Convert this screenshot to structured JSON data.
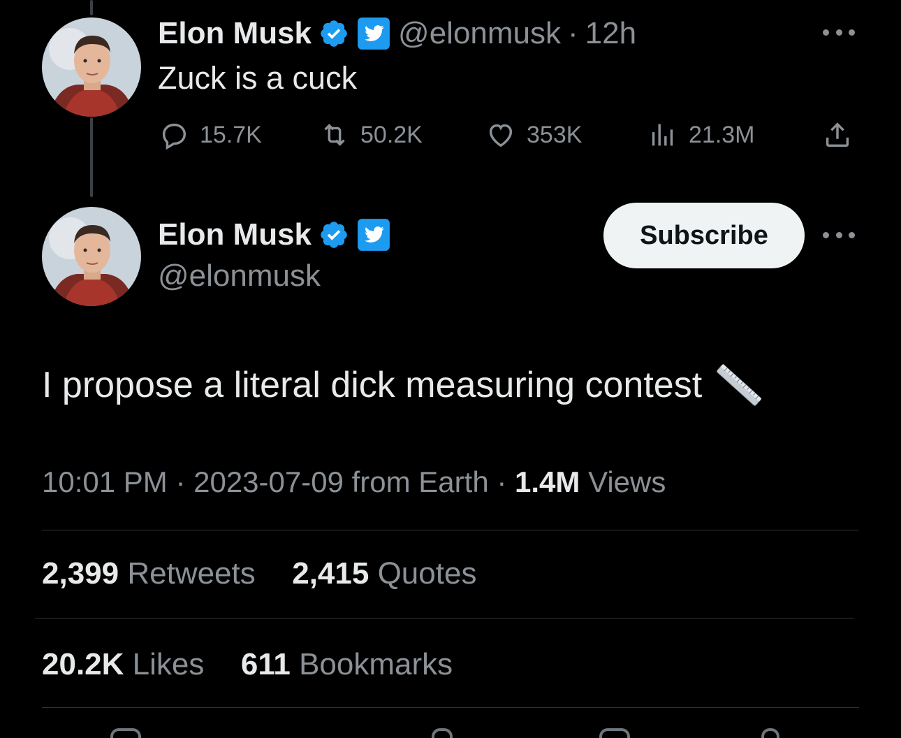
{
  "reply_tweet": {
    "author_name": "Elon Musk",
    "handle": "@elonmusk",
    "separator": "·",
    "time_ago": "12h",
    "text": "Zuck is a cuck",
    "replies": "15.7K",
    "retweets": "50.2K",
    "likes": "353K",
    "views": "21.3M"
  },
  "main_tweet": {
    "author_name": "Elon Musk",
    "handle": "@elonmusk",
    "subscribe_label": "Subscribe",
    "text": "I propose a literal dick measuring contest",
    "emoji": "straight-ruler-icon",
    "time": "10:01 PM",
    "date": "2023-07-09",
    "source": "from Earth",
    "views_count": "1.4M",
    "views_label": "Views",
    "retweets_count": "2,399",
    "retweets_label": "Retweets",
    "quotes_count": "2,415",
    "quotes_label": "Quotes",
    "likes_count": "20.2K",
    "likes_label": "Likes",
    "bookmarks_count": "611",
    "bookmarks_label": "Bookmarks"
  },
  "colors": {
    "background": "#000000",
    "primary_text": "#e7e9ea",
    "secondary_text": "#8b9196",
    "verified_blue": "#1d9bf0",
    "divider": "#2f3336"
  }
}
